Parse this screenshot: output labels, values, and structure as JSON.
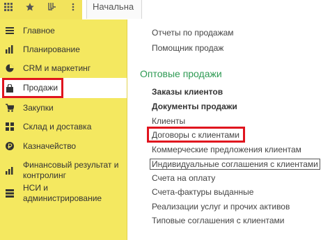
{
  "toolbar": {
    "icons": [
      "grid-icon",
      "star-icon",
      "history-icon"
    ],
    "tab_label": "Начальна"
  },
  "sidebar": {
    "items": [
      {
        "icon": "menu-lines-icon",
        "label": "Главное"
      },
      {
        "icon": "chart-bars-icon",
        "label": "Планирование"
      },
      {
        "icon": "pie-chart-icon",
        "label": "CRM и маркетинг"
      },
      {
        "icon": "shopping-bag-icon",
        "label": "Продажи",
        "active": true
      },
      {
        "icon": "cart-icon",
        "label": "Закупки"
      },
      {
        "icon": "warehouse-icon",
        "label": "Склад и доставка"
      },
      {
        "icon": "ruble-coin-icon",
        "label": "Казначейство"
      },
      {
        "icon": "finance-chart-icon",
        "label": "Финансовый результат и контролинг"
      },
      {
        "icon": "settings-list-icon",
        "label": "НСИ и администрирование"
      }
    ],
    "finance_line1": "Финансовый результат и",
    "finance_line2": "контролинг"
  },
  "main": {
    "top_links": [
      "Отчеты по продажам",
      "Помощник продаж"
    ],
    "section_title": "Оптовые продажи",
    "links": [
      {
        "label": "Заказы клиентов",
        "bold": true
      },
      {
        "label": "Документы продажи",
        "bold": true
      },
      {
        "label": "Клиенты"
      },
      {
        "label": "Договоры с клиентами",
        "highlighted": true
      },
      {
        "label": "Коммерческие предложения клиентам"
      },
      {
        "label": "Индивидуальные соглашения с клиентами",
        "boxed": true
      },
      {
        "label": "Счета на оплату"
      },
      {
        "label": "Счета-фактуры выданные"
      },
      {
        "label": "Реализации услуг и прочих активов"
      },
      {
        "label": "Типовые соглашения с клиентами"
      }
    ]
  },
  "colors": {
    "sidebar_bg": "#f4e860",
    "section_green": "#2e9a53",
    "highlight_red": "#e0141e"
  }
}
